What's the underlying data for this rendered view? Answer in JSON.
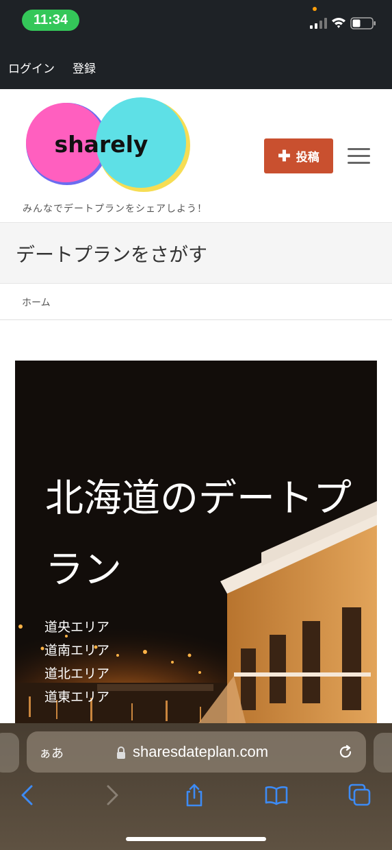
{
  "status_bar": {
    "time": "11:34"
  },
  "top_links": {
    "login": "ログイン",
    "register": "登録"
  },
  "header": {
    "logo_text": "sharely",
    "tagline": "みんなでデートプランをシェアしよう！",
    "post_button_label": "投稿",
    "colors": {
      "logo_pink": "#ff5fbf",
      "logo_cyan": "#5ee0e6",
      "post_button": "#c9502f"
    }
  },
  "page_title": "デートプランをさがす",
  "breadcrumb": {
    "home": "ホーム"
  },
  "hero": {
    "title": "北海道のデートプラン",
    "areas": [
      "道央エリア",
      "道南エリア",
      "道北エリア",
      "道東エリア"
    ]
  },
  "browser": {
    "aa_label": "ぁあ",
    "url": "sharesdateplan.com"
  }
}
